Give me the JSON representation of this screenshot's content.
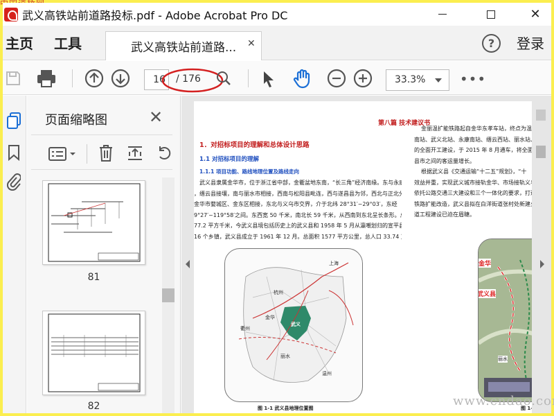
{
  "watermark_top": "中国道桥网",
  "window": {
    "title": "武义高铁站前道路投标.pdf - Adobe Acrobat Pro DC",
    "minimize": "—",
    "maximize": "☐",
    "close": "✕"
  },
  "nav": {
    "home": "主页",
    "tools": "工具",
    "login": "登录"
  },
  "tab": {
    "label": "武义高铁站前道路...",
    "close": "✕"
  },
  "toolbar": {
    "page_current": "16",
    "page_total": "/ 176",
    "zoom": "33.3%"
  },
  "panel": {
    "title": "页面缩略图",
    "close": "✕"
  },
  "thumbnails": [
    {
      "page": "81"
    },
    {
      "page": "82"
    }
  ],
  "doc": {
    "part_title": "第八篇  技术建议书",
    "h1": "1．对招标项目的理解和总体设计思路",
    "h2": "1.1 对招标项目的理解",
    "h3": "1.1.1 项目功能、路线地理位置及路线走向",
    "para_lines": [
      "武义县隶属金华市，位于浙江省中部，金衢盆地东南，“长三角”经济南缘。东与永康",
      "，缙云县接壤，南与丽水市相接，西南与松阳县毗连，西与遂昌县为邻，西北与正北分别",
      "金华市婺城区、金东区相接，东北与义乌市交界，介于北纬 28°31′~29°03′，东经",
      "9°27′~119°58′之间。东西宽 50 千米，南北长 59 千米，从西南到东北呈长条形。总面积",
      "77.2 平方千米，今武义县境包括历史上的武义县和 1958 年 5 月从瀛嘲划归的宣平县划入",
      "16 个乡镇，武义县成立于 1961 年 12 月。总面积 1577 平方公里，总人口 33.74 万人。"
    ],
    "right_lines": [
      "金丽温扩能铁路起自金华东孝车站，终点为温州",
      "南站、武义北站、永康南站、缙云西站、丽水站、",
      "的全面开工建设，于 2015 年 8 月通车，将全面",
      "县市之间的客运量增长。",
      "根据武义县《交通运输“十二五”规划》，“十",
      "效益并重，实现武义城市接轨金华、市场接轨义乌、",
      "依托公路交通三大建设和三个一体化的要求，打造",
      "铁路扩能改造，武义县拟在白洋街道张村处新建火",
      "道工程建设已迫在眉睫。"
    ],
    "map_cities": [
      "金华",
      "武义",
      "丽水",
      "杭州",
      "温州",
      "衢州",
      "上海"
    ],
    "map_caption": "图 1-1 武义县地理位置图",
    "photo_labels": [
      "金华",
      "武义县",
      "丽水"
    ],
    "photo_caption": "图 1-2"
  },
  "watermark_bottom": "www.cndao.com"
}
